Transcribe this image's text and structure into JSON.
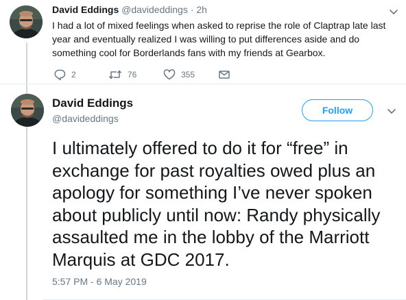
{
  "reply_context_tweet": {
    "display_name": "David Eddings",
    "handle": "@davideddings",
    "separator": "·",
    "relative_time": "2h",
    "text": "I had a lot of mixed feelings when asked to reprise the role of Claptrap late last year and eventually realized I was willing to put differences aside and do something cool for Borderlands fans with my friends at Gearbox.",
    "actions": {
      "reply_count": "2",
      "retweet_count": "76",
      "like_count": "355"
    },
    "icons": [
      "reply-icon",
      "retweet-icon",
      "like-icon",
      "direct-message-icon",
      "chevron-down-icon"
    ]
  },
  "main_tweet": {
    "display_name": "David Eddings",
    "handle": "@davideddings",
    "follow_label": "Follow",
    "text": "I ultimately offered to do it for “free” in exchange for past royalties owed plus an apology for something I’ve never spoken about publicly until now: Randy physically assaulted me in the lobby of the Marriott Marquis at GDC 2017.",
    "timestamp": "5:57 PM - 6 May 2019"
  },
  "colors": {
    "accent": "#1da1f2",
    "secondary_text": "#657786",
    "primary_text": "#14171a",
    "thread_line": "#ccd6dd"
  }
}
